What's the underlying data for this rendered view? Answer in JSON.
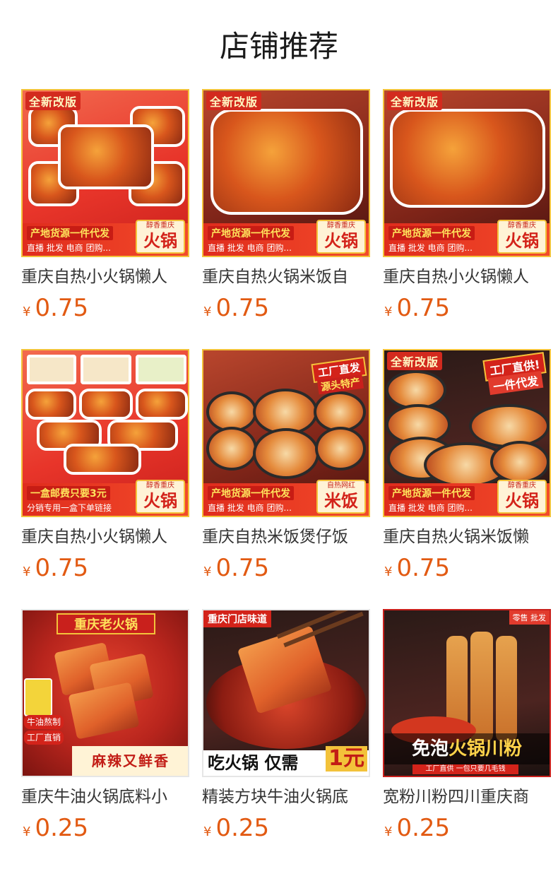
{
  "section": {
    "title": "店铺推荐"
  },
  "currency": "¥",
  "products": [
    {
      "title": "重庆自热小火锅懒人",
      "price": "0.75",
      "tag_new": "全新改版",
      "banner_top": "产地货源一件代发",
      "banner_bottom": "直播 批发 电商 团购...",
      "tag_small": "醇香重庆",
      "tag_big": "火锅"
    },
    {
      "title": "重庆自热火锅米饭自",
      "price": "0.75",
      "tag_new": "全新改版",
      "banner_top": "产地货源一件代发",
      "banner_bottom": "直播 批发 电商 团购...",
      "tag_small": "醇香重庆",
      "tag_big": "火锅"
    },
    {
      "title": "重庆自热小火锅懒人",
      "price": "0.75",
      "tag_new": "全新改版",
      "banner_top": "产地货源一件代发",
      "banner_bottom": "直播 批发 电商 团购...",
      "tag_small": "醇香重庆",
      "tag_big": "火锅"
    },
    {
      "title": "重庆自热小火锅懒人",
      "price": "0.75",
      "banner_top": "一盒邮费只要3元",
      "banner_bottom": "分销专用一盒下单链接",
      "tag_small": "醇香重庆",
      "tag_big": "火锅"
    },
    {
      "title": "重庆自热米饭煲仔饭",
      "price": "0.75",
      "badge_factory": "工厂直发",
      "badge_factory_sub": "源头特产",
      "banner_top": "产地货源一件代发",
      "banner_bottom": "直播 批发 电商 团购...",
      "tag_small": "自热网红",
      "tag_big": "米饭"
    },
    {
      "title": "重庆自热火锅米饭懒",
      "price": "0.75",
      "tag_new": "全新改版",
      "badge_factory": "工厂直供!",
      "badge_factory_sub": "一件代发",
      "banner_top": "产地货源一件代发",
      "banner_bottom": "直播 批发 电商 团购...",
      "tag_small": "醇香重庆",
      "tag_big": "火锅"
    },
    {
      "title": "重庆牛油火锅底料小",
      "price": "0.25",
      "poster_title": "重庆老火锅",
      "poster_side_1": "牛油熬制",
      "poster_side_2": "工厂直销",
      "poster_caption": "麻辣又鲜香"
    },
    {
      "title": "精装方块牛油火锅底",
      "price": "0.25",
      "poster_top": "重庆门店味道",
      "caption_text": "吃火锅 仅需",
      "caption_price": "1元"
    },
    {
      "title": "宽粉川粉四川重庆商",
      "price": "0.25",
      "corner_tag": "零售 批发",
      "noodle_caption_1": "免泡",
      "noodle_caption_2": "火锅川粉",
      "noodle_sub": "工厂直供  一包只要几毛钱"
    }
  ]
}
